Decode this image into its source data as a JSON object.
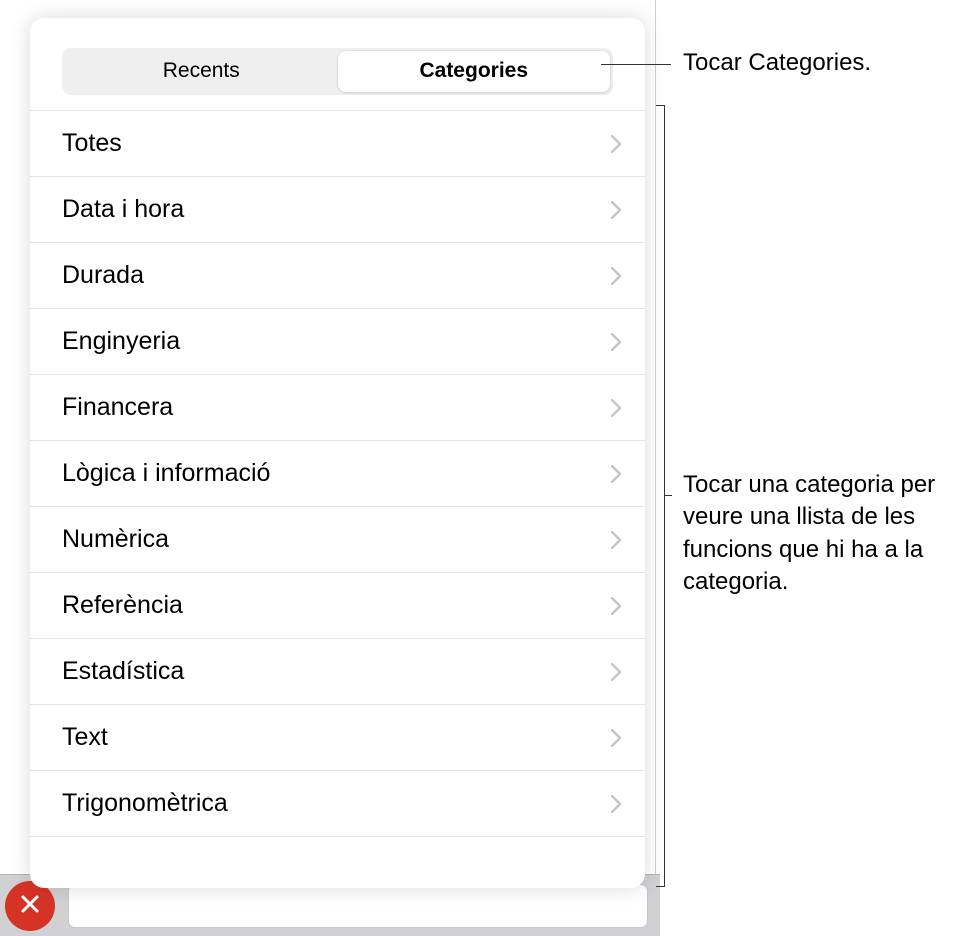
{
  "tabs": {
    "recents": "Recents",
    "categories": "Categories"
  },
  "categories": [
    {
      "label": "Totes"
    },
    {
      "label": "Data i hora"
    },
    {
      "label": "Durada"
    },
    {
      "label": "Enginyeria"
    },
    {
      "label": "Financera"
    },
    {
      "label": "Lògica i informació"
    },
    {
      "label": "Numèrica"
    },
    {
      "label": "Referència"
    },
    {
      "label": "Estadística"
    },
    {
      "label": "Text"
    },
    {
      "label": "Trigonomètrica"
    }
  ],
  "callouts": {
    "tap_categories": "Tocar Categories.",
    "tap_category": "Tocar una categoria per veure una llista de les funcions que hi ha a la categoria."
  }
}
